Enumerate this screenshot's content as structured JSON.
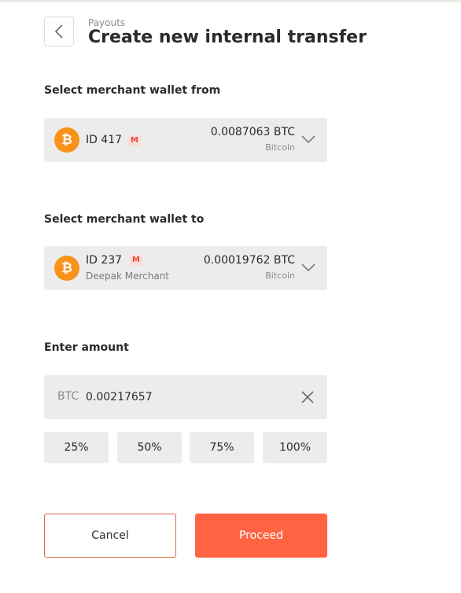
{
  "header": {
    "breadcrumb": "Payouts",
    "title": "Create new internal transfer"
  },
  "from": {
    "label": "Select merchant wallet from",
    "wallet_id": "ID 417",
    "badge": "M",
    "merchant": "",
    "amount": "0.0087063 BTC",
    "currency": "Bitcoin",
    "coin_symbol": "₿"
  },
  "to": {
    "label": "Select merchant wallet to",
    "wallet_id": "ID 237",
    "badge": "M",
    "merchant": "Deepak Merchant",
    "amount": "0.00019762 BTC",
    "currency": "Bitcoin",
    "coin_symbol": "₿"
  },
  "amount": {
    "label": "Enter amount",
    "currency": "BTC",
    "value": "0.00217657"
  },
  "percent_buttons": [
    "25%",
    "50%",
    "75%",
    "100%"
  ],
  "actions": {
    "cancel": "Cancel",
    "proceed": "Proceed"
  },
  "colors": {
    "accent": "#ff6342",
    "bitcoin": "#f7931a",
    "field_bg": "#ececec"
  }
}
